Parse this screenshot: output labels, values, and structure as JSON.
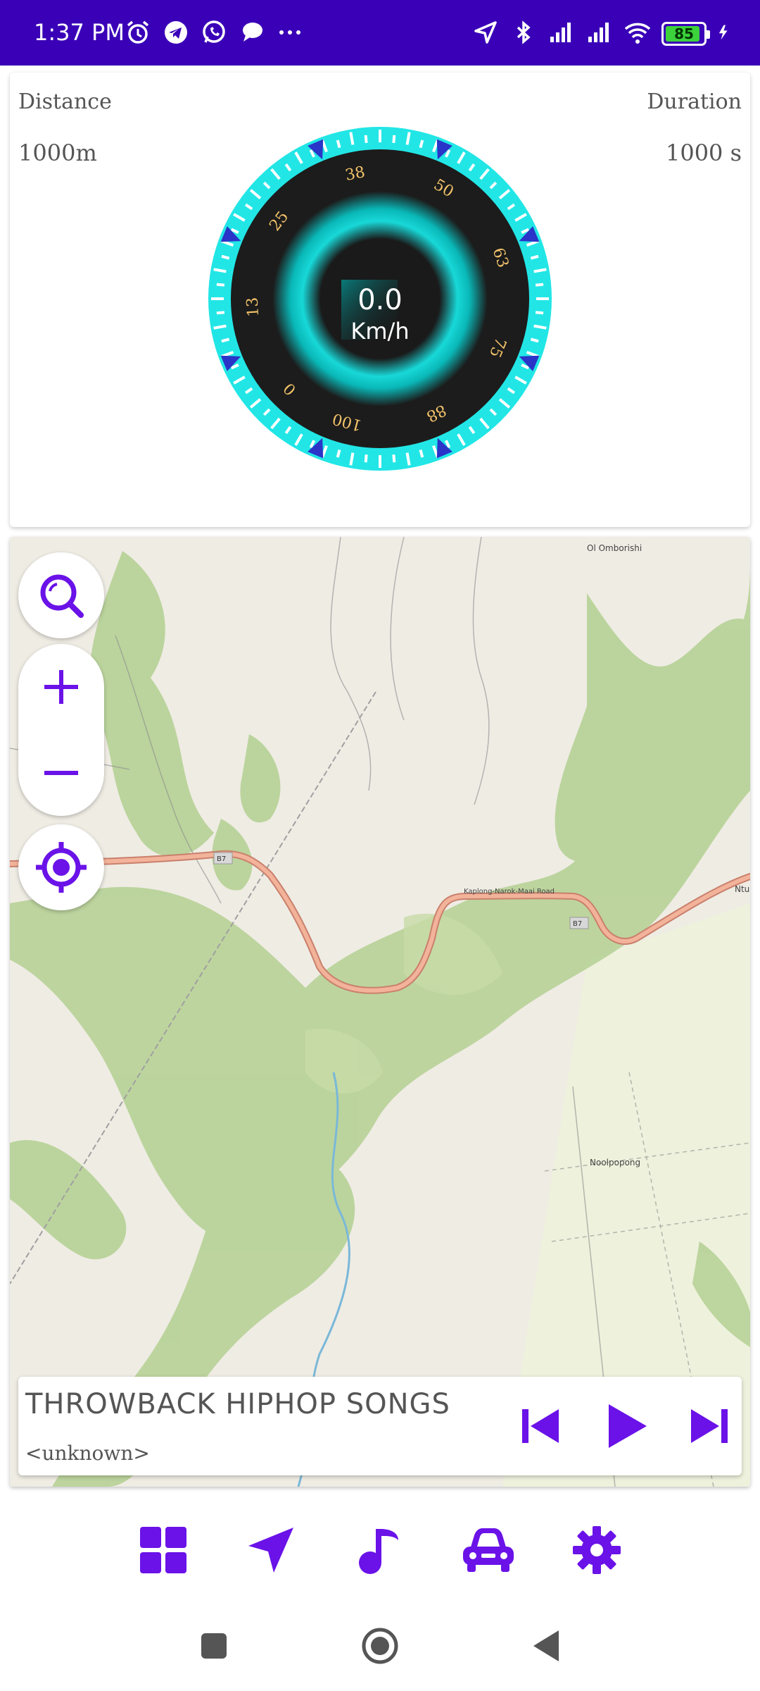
{
  "status_bar": {
    "time": "1:37 PM",
    "battery_level": "85",
    "left_icons": [
      "alarm-icon",
      "telegram-icon",
      "whatsapp-icon",
      "chat-bubble-icon",
      "more-dots-icon"
    ],
    "right_icons": [
      "location-arrow-icon",
      "bluetooth-icon",
      "signal-icon",
      "signal-icon",
      "wifi-icon",
      "battery-icon",
      "charging-icon"
    ],
    "bar_color": "#3a00b8"
  },
  "speed_panel": {
    "distance_label": "Distance",
    "distance_value": "1000m",
    "duration_label": "Duration",
    "duration_value": "1000 s",
    "speed_value": "0.0",
    "speed_unit": "Km/h",
    "dial_labels": [
      "0",
      "13",
      "25",
      "38",
      "50",
      "63",
      "75",
      "88",
      "100"
    ],
    "accent_color": "#1fe0e0",
    "label_color": "#f4c46a",
    "marker_color": "#2a34c8"
  },
  "map": {
    "place_labels": [
      "Ol Omborishi",
      "Kaplong-Narok-Maai Road",
      "Noolpopong",
      "B7",
      "B7",
      "Ntul"
    ],
    "controls": [
      "search-icon",
      "zoom-in-icon",
      "zoom-out-icon",
      "my-location-icon"
    ]
  },
  "music_player": {
    "title": "THROWBACK HIPHOP SONGS",
    "artist": "<unknown>",
    "controls": [
      "skip-previous-icon",
      "play-icon",
      "skip-next-icon"
    ]
  },
  "bottom_nav": {
    "items": [
      "dashboard-icon",
      "navigation-icon",
      "music-note-icon",
      "car-icon",
      "settings-icon"
    ],
    "color": "#6a12e8"
  }
}
